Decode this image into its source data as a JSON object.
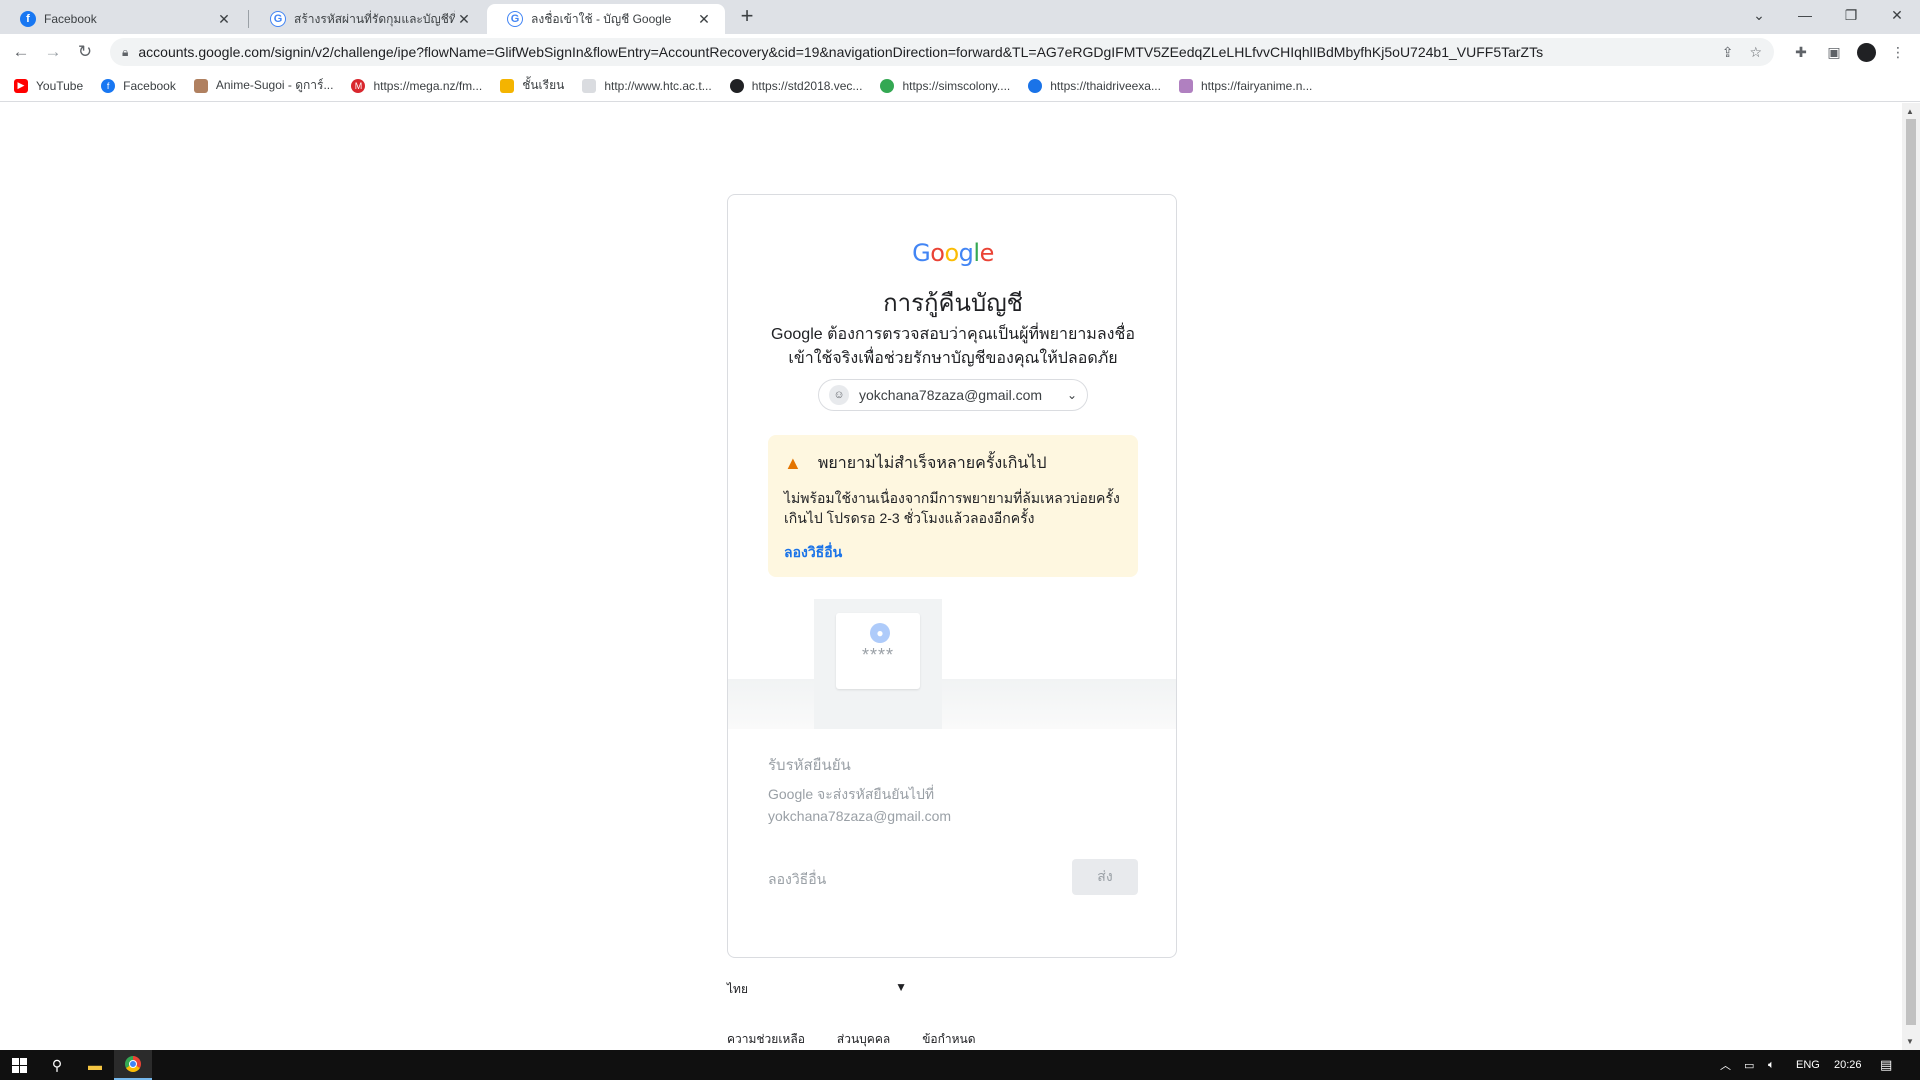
{
  "browser": {
    "tabs": [
      {
        "title": "Facebook",
        "favicon": "facebook-icon",
        "active": false
      },
      {
        "title": "สร้างรหัสผ่านที่รัดกุมและบัญชีที่มีความ",
        "favicon": "google-icon",
        "active": false
      },
      {
        "title": "ลงชื่อเข้าใช้ - บัญชี Google",
        "favicon": "google-icon",
        "active": true
      }
    ],
    "url": "accounts.google.com/signin/v2/challenge/ipe?flowName=GlifWebSignIn&flowEntry=AccountRecovery&cid=19&navigationDirection=forward&TL=AG7eRGDgIFMTV5ZEedqZLeLHLfvvCHIqhlIBdMbyfhKj5oU724b1_VUFF5TarZTs",
    "bookmarks": [
      {
        "label": "YouTube",
        "icon": "youtube-icon",
        "color": "#ff0000"
      },
      {
        "label": "Facebook",
        "icon": "facebook-icon",
        "color": "#1877f2"
      },
      {
        "label": "Anime-Sugoi - ดูการ์...",
        "icon": "anime-icon",
        "color": "#b08060"
      },
      {
        "label": "https://mega.nz/fm...",
        "icon": "mega-icon",
        "color": "#d9272e"
      },
      {
        "label": "ชั้นเรียน",
        "icon": "classroom-icon",
        "color": "#f4b400"
      },
      {
        "label": "http://www.htc.ac.t...",
        "icon": "web-icon",
        "color": "#9aa0a6"
      },
      {
        "label": "https://std2018.vec...",
        "icon": "globe-icon",
        "color": "#202124"
      },
      {
        "label": "https://simscolony....",
        "icon": "sims-icon",
        "color": "#34a853"
      },
      {
        "label": "https://thaidriveexa...",
        "icon": "thaidrive-icon",
        "color": "#1a73e8"
      },
      {
        "label": "https://fairyanime.n...",
        "icon": "fairy-icon",
        "color": "#b080c0"
      }
    ]
  },
  "card": {
    "logo": "Google",
    "heading": "การกู้คืนบัญชี",
    "subtext": "Google ต้องการตรวจสอบว่าคุณเป็นผู้ที่พยายามลงชื่อเข้าใช้จริงเพื่อช่วยรักษาบัญชีของคุณให้ปลอดภัย",
    "email": "yokchana78zaza@gmail.com",
    "warning": {
      "title": "พยายามไม่สำเร็จหลายครั้งเกินไป",
      "body": "ไม่พร้อมใช้งานเนื่องจากมีการพยายามที่ล้มเหลวบ่อยครั้งเกินไป โปรดรอ 2-3 ชั่วโมงแล้วลองอีกครั้ง",
      "link": "ลองวิธีอื่น"
    },
    "illustration_stars": "****",
    "section_title": "รับรหัสยืนยัน",
    "section_body_line1": "Google จะส่งรหัสยืนยันไปที่",
    "section_body_line2": "yokchana78zaza@gmail.com",
    "try_other": "ลองวิธีอื่น",
    "send_label": "ส่ง"
  },
  "footer": {
    "language": "ไทย",
    "links": [
      "ความช่วยเหลือ",
      "ส่วนบุคคล",
      "ข้อกำหนด"
    ]
  },
  "taskbar": {
    "lang": "ENG",
    "time": "20:26"
  },
  "colors": {
    "accent": "#1a73e8",
    "warning_bg": "#fef7e0",
    "warning_icon": "#e37400"
  }
}
